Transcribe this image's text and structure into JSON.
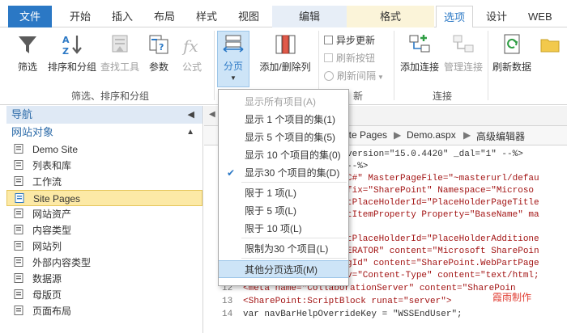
{
  "tabs": {
    "file": "文件",
    "home": "开始",
    "insert": "插入",
    "layout": "布局",
    "style": "样式",
    "view": "视图",
    "edit": "编辑",
    "format": "格式",
    "options": "选项",
    "design": "设计",
    "web": "WEB"
  },
  "ribbon": {
    "filter": "筛选",
    "sort_group": "排序和分组",
    "find_tool": "查找工具",
    "params": "参数",
    "formula": "公式",
    "paging": "分页",
    "add_remove_cols": "添加/删除列",
    "async_update": "异步更新",
    "refresh_button": "刷新按钮",
    "refresh_interval": "刷新间隔",
    "group_filter_label": "筛选、排序和分组",
    "group_update_label": "新",
    "add_connection": "添加连接",
    "manage_connection": "管理连接",
    "group_connection_label": "连接",
    "refresh_data": "刷新数据"
  },
  "nav": {
    "header": "导航",
    "section": "网站对象",
    "items": [
      {
        "label": "Demo Site",
        "icon": "home-icon"
      },
      {
        "label": "列表和库",
        "icon": "list-icon"
      },
      {
        "label": "工作流",
        "icon": "workflow-icon"
      },
      {
        "label": "Site Pages",
        "icon": "page-icon"
      },
      {
        "label": "网站资产",
        "icon": "asset-icon"
      },
      {
        "label": "内容类型",
        "icon": "content-type-icon"
      },
      {
        "label": "网站列",
        "icon": "column-icon"
      },
      {
        "label": "外部内容类型",
        "icon": "external-icon"
      },
      {
        "label": "数据源",
        "icon": "datasource-icon"
      },
      {
        "label": "母版页",
        "icon": "master-icon"
      },
      {
        "label": "页面布局",
        "icon": "layout-icon"
      }
    ]
  },
  "breadcrumb": {
    "part1": "ite Pages",
    "part2": "Demo.aspx",
    "part3": "高级编辑器"
  },
  "code": {
    "l1": "version=\"15.0.4420\" _dal=\"1\" --%>",
    "l2": "--%>",
    "l3": "C#\" MasterPageFile=\"~masterurl/defau",
    "l4": "fix=\"SharePoint\" Namespace=\"Microso",
    "l5": "tPlaceHolderId=\"PlaceHolderPageTitle",
    "l6": "tItemProperty Property=\"BaseName\" ma",
    "l7": "tPlaceHolderId=\"PlaceHolderAdditione",
    "l8": "ERATOR\" content=\"Microsoft SharePoin",
    "l9": "gId\" content=\"SharePoint.WebPartPage",
    "l10": "v=\"Content-Type\" content=\"text/html;",
    "l12_num": "12",
    "l12": "<meta name=\"CollaborationServer\" content=\"SharePoin",
    "l13_num": "13",
    "l13": "<SharePoint:ScriptBlock runat=\"server\">",
    "l14_num": "14",
    "l14": "var navBarHelpOverrideKey = \"WSSEndUser\";"
  },
  "menu": {
    "items": [
      {
        "label": "显示所有项目(A)",
        "disabled": true
      },
      {
        "label": "显示 1 个项目的集(1)"
      },
      {
        "label": "显示 5 个项目的集(5)"
      },
      {
        "label": "显示 10 个项目的集(0)"
      },
      {
        "label": "显示30 个项目的集(D)",
        "checked": true
      },
      {
        "label": "限于 1 项(L)"
      },
      {
        "label": "限于 5 项(L)"
      },
      {
        "label": "限于 10 项(L)"
      },
      {
        "label": "限制为30 个项目(L)"
      },
      {
        "label": "其他分页选项(M)",
        "hover": true
      }
    ]
  },
  "watermark": "霞雨制作",
  "colors": {
    "accent": "#2b78c5",
    "selected_bg": "#fce9a6",
    "hover_bg": "#cde4f7"
  }
}
